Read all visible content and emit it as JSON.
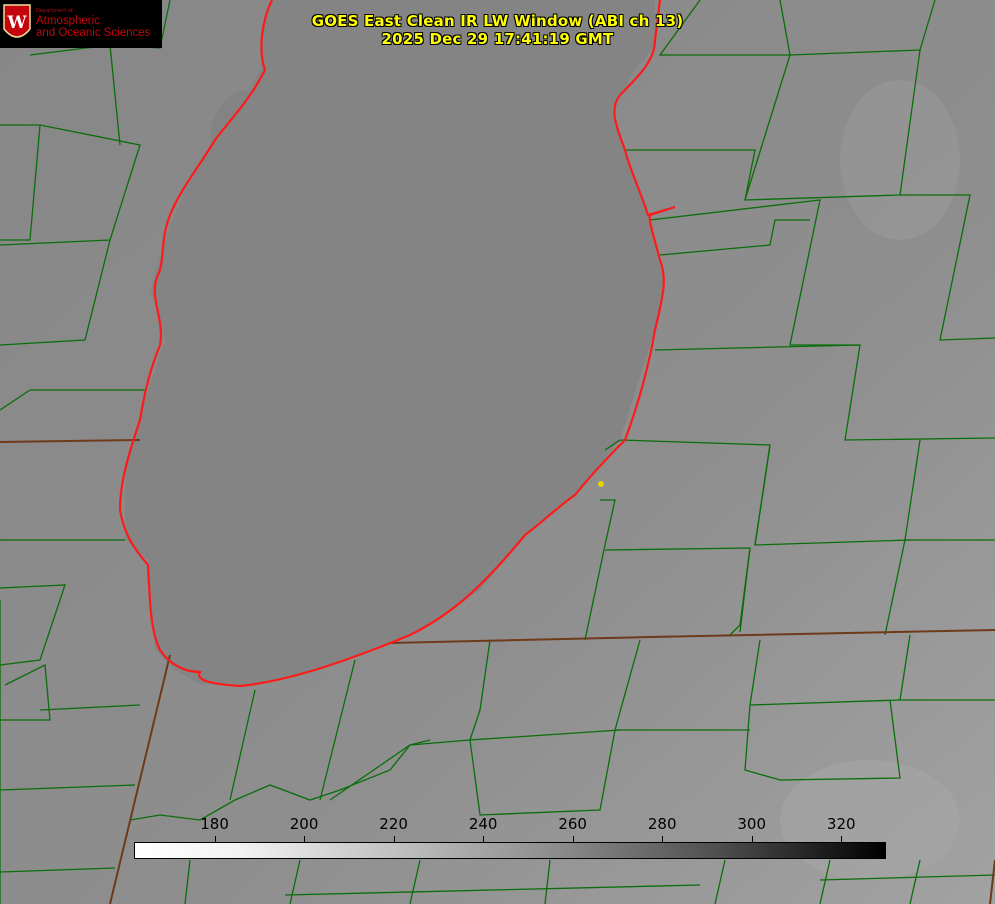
{
  "title": {
    "line1": "GOES East Clean IR LW Window (ABI ch 13)",
    "line2": "2025 Dec 29 17:41:19 GMT"
  },
  "logo": {
    "dept": "Department of",
    "line1": "Atmospheric",
    "line2": "and Oceanic Sciences",
    "seal_letter": "W"
  },
  "colorbar": {
    "ticks": [
      "180",
      "200",
      "220",
      "240",
      "260",
      "280",
      "300",
      "320"
    ],
    "tick_values": [
      180,
      200,
      220,
      240,
      260,
      280,
      300,
      320
    ],
    "range": [
      162,
      330
    ],
    "gradient": "white-to-black"
  },
  "colors": {
    "background": "#8c8c8c",
    "lake": "#848484",
    "county_lines": "#0a6e0a",
    "shoreline": "#ff1a1a",
    "title_text": "#ffff00",
    "marker": "#e6d200"
  },
  "map": {
    "overlays": [
      "county-boundaries",
      "lake-shoreline",
      "state-boundary"
    ],
    "marker": "yellow-dot"
  }
}
